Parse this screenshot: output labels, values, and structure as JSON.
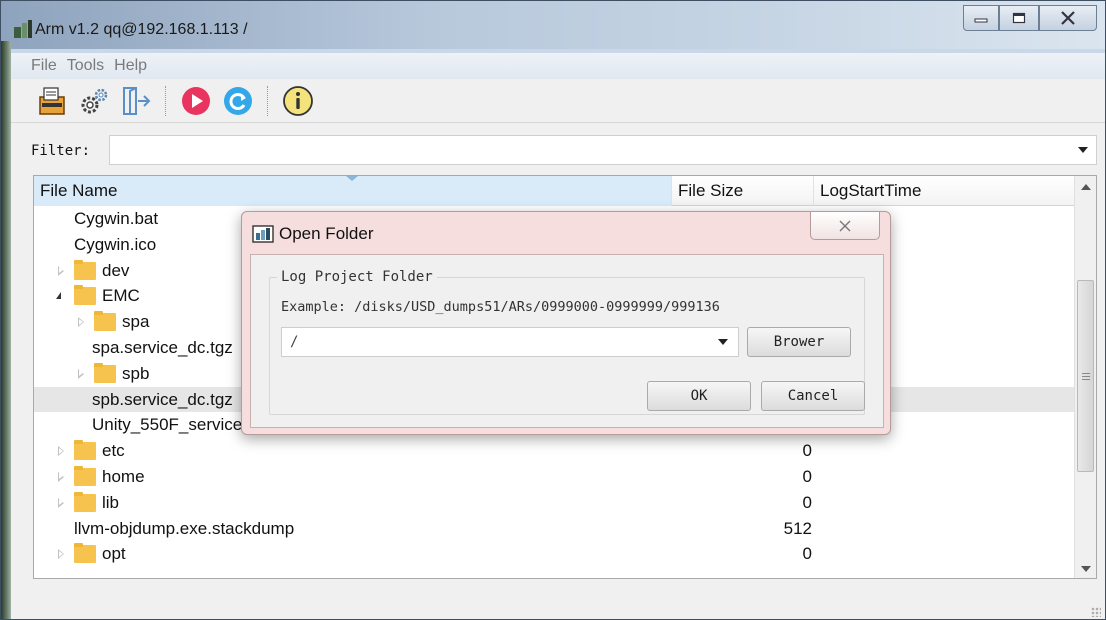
{
  "window": {
    "title": "Arm v1.2 qq@192.168.1.113 /"
  },
  "menu": {
    "items": [
      "File",
      "Tools",
      "Help"
    ]
  },
  "toolbar": {
    "buttons": [
      "open-folder-icon",
      "settings-gears-icon",
      "exit-icon",
      "play-icon",
      "refresh-icon",
      "info-icon"
    ]
  },
  "filter": {
    "label": "Filter:",
    "value": ""
  },
  "tree": {
    "columns": [
      "File Name",
      "File Size",
      "LogStartTime"
    ],
    "rows": [
      {
        "name": "Cygwin.bat",
        "size": "",
        "type": "file",
        "depth": 0
      },
      {
        "name": "Cygwin.ico",
        "size": "",
        "type": "file",
        "depth": 0
      },
      {
        "name": "dev",
        "size": "",
        "type": "folder",
        "state": "collapsed",
        "depth": 0
      },
      {
        "name": "EMC",
        "size": "",
        "type": "folder",
        "state": "expanded",
        "depth": 0
      },
      {
        "name": "spa",
        "size": "",
        "type": "folder",
        "state": "collapsed",
        "depth": 1
      },
      {
        "name": "spa.service_dc.tgz",
        "size": "",
        "type": "file",
        "depth": 1
      },
      {
        "name": "spb",
        "size": "",
        "type": "folder",
        "state": "collapsed",
        "depth": 1
      },
      {
        "name": "spb.service_dc.tgz",
        "size": "",
        "type": "file",
        "depth": 1,
        "selected": true
      },
      {
        "name": "Unity_550F_service",
        "size": "",
        "type": "file",
        "depth": 1
      },
      {
        "name": "etc",
        "size": "0",
        "type": "folder",
        "state": "collapsed",
        "depth": 0
      },
      {
        "name": "home",
        "size": "0",
        "type": "folder",
        "state": "collapsed",
        "depth": 0
      },
      {
        "name": "lib",
        "size": "0",
        "type": "folder",
        "state": "collapsed",
        "depth": 0
      },
      {
        "name": "llvm-objdump.exe.stackdump",
        "size": "512",
        "type": "file",
        "depth": 0
      },
      {
        "name": "opt",
        "size": "0",
        "type": "folder",
        "state": "collapsed",
        "depth": 0
      }
    ]
  },
  "dialog": {
    "title": "Open Folder",
    "group_title": "Log Project Folder",
    "example": "Example: /disks/USD_dumps51/ARs/0999000-0999999/999136",
    "path_value": "/",
    "browse_label": "Brower",
    "ok_label": "OK",
    "cancel_label": "Cancel"
  }
}
